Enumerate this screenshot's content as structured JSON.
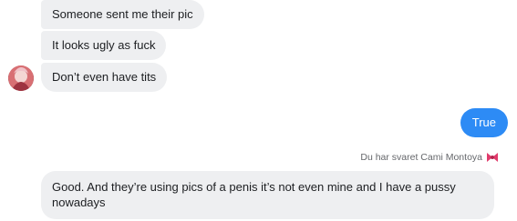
{
  "messages": {
    "m1": "Someone sent me their pic",
    "m2": "It looks ugly as fuck",
    "m3": "Don’t even have tits",
    "outgoing": "True",
    "reply_meta": "Du har svaret Cami Montoya",
    "reply_text": "Good. And they’re using pics of a penis it’s not even mine and I have a pussy nowadays"
  },
  "icons": {
    "avatar": "profile-avatar",
    "reply_emoji": "ribbon-bow-icon"
  },
  "colors": {
    "incoming_bg": "#eeeff1",
    "outgoing_bg": "#2d8bf5",
    "meta_text": "#65676b"
  }
}
